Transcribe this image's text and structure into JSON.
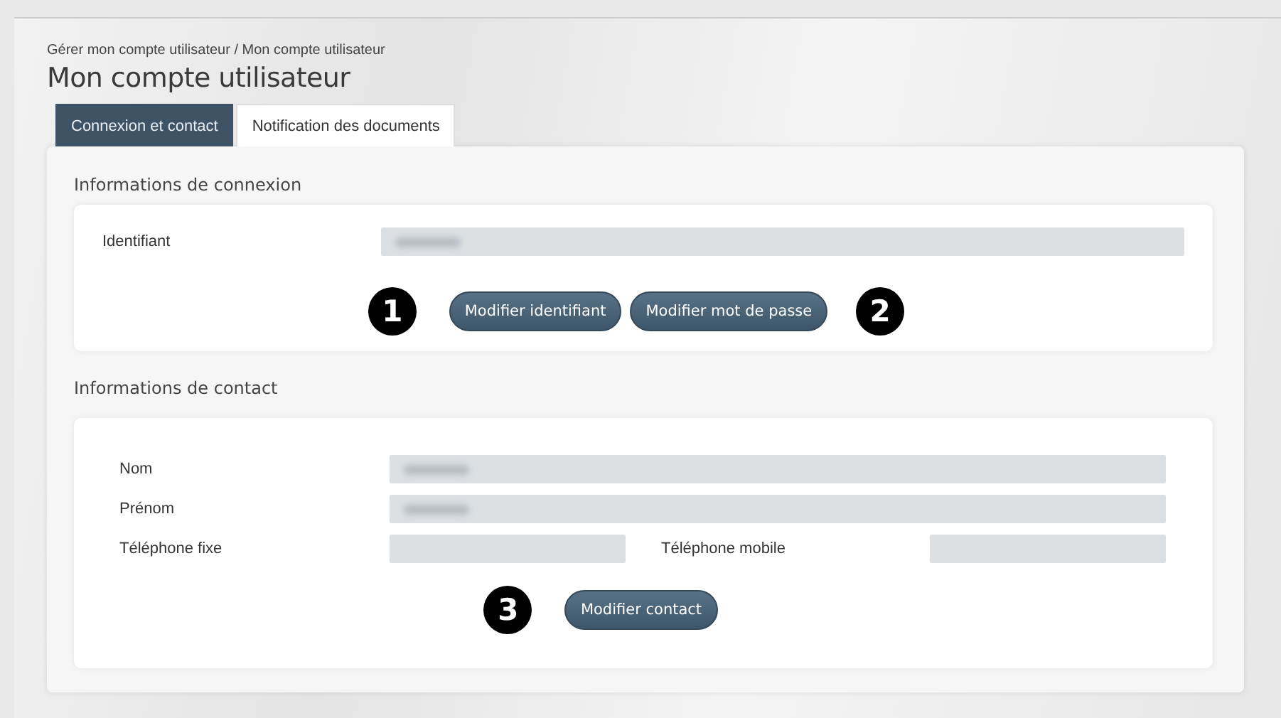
{
  "breadcrumb": "Gérer mon compte utilisateur / Mon compte utilisateur",
  "title": "Mon compte utilisateur",
  "tabs": [
    {
      "label": "Connexion et contact",
      "selected": true
    },
    {
      "label": "Notification des documents",
      "selected": false
    }
  ],
  "login_section": {
    "heading": "Informations de connexion",
    "fields": [
      {
        "label": "Identifiant",
        "redacted": true
      }
    ],
    "buttons": [
      {
        "callout": "1",
        "label": "Modifier identifiant"
      },
      {
        "label": "Modifier mot de passe",
        "callout": "2"
      }
    ]
  },
  "contact_section": {
    "heading": "Informations de contact",
    "fields": [
      {
        "label": "Nom",
        "redacted": true,
        "kind": "wide"
      },
      {
        "label": "Prénom",
        "redacted": true,
        "kind": "wide"
      },
      {
        "label": "Téléphone fixe",
        "redacted": false,
        "kind": "half"
      },
      {
        "label": "Téléphone mobile",
        "redacted": false,
        "kind": "half"
      }
    ],
    "buttons": [
      {
        "callout": "3",
        "label": "Modifier contact"
      }
    ]
  }
}
